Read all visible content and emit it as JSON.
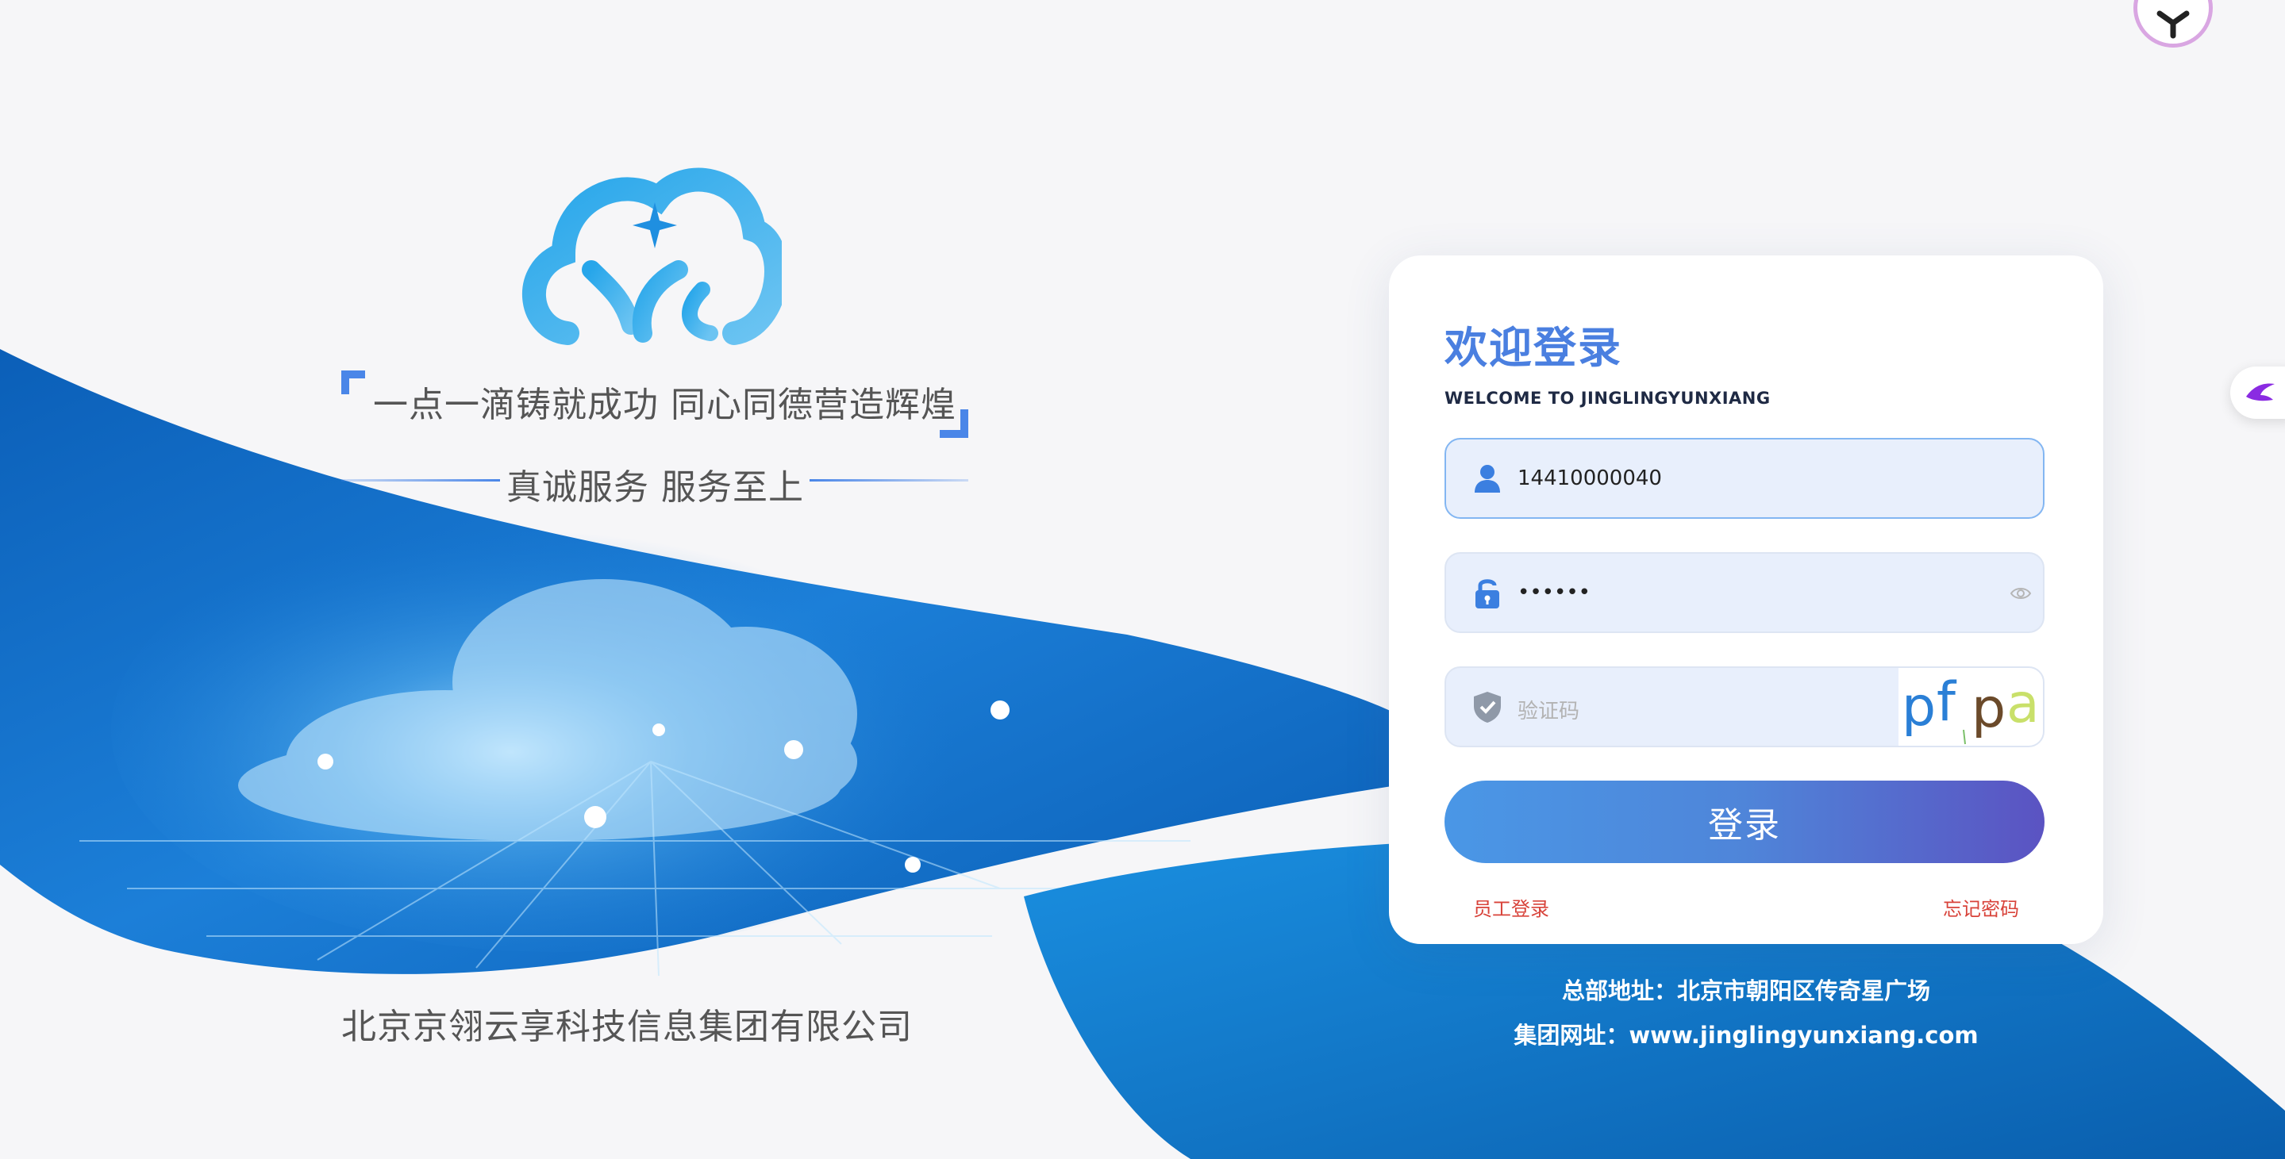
{
  "hero": {
    "slogan": "一点一滴铸就成功 同心同德营造辉煌",
    "motto": "真诚服务  服务至上",
    "company": "北京京翎云享科技信息集团有限公司"
  },
  "login": {
    "title": "欢迎登录",
    "subtitle": "WELCOME TO JINGLINGYUNXIANG",
    "username_value": "14410000040",
    "password_value": "••••••",
    "captcha_placeholder": "验证码",
    "captcha_text": [
      "p",
      "f",
      "p",
      "a"
    ],
    "submit_label": "登录",
    "employee_login": "员工登录",
    "forgot_password": "忘记密码"
  },
  "footer": {
    "address": "总部地址：北京市朝阳区传奇星广场",
    "website": "集团网址：www.jinglingyunxiang.com"
  },
  "icons": {
    "user": "user-icon",
    "lock": "lock-icon",
    "shield": "shield-check-icon",
    "eye": "eye-icon"
  },
  "colors": {
    "accent": "#4a7fe0",
    "button_start": "#4a97e6",
    "button_end": "#5b53c2",
    "link": "#d8433a",
    "wave_blue": "#0a6fc8"
  }
}
